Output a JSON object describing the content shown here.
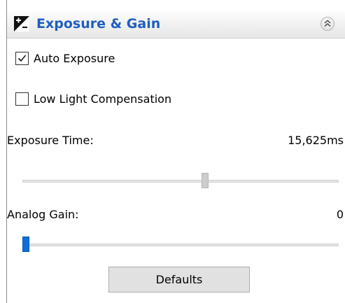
{
  "header": {
    "title": "Exposure & Gain",
    "icon": "exposure-icon",
    "collapse_icon": "double-chevron-up-icon",
    "title_color": "#1f5fbf"
  },
  "controls": {
    "auto_exposure": {
      "label": "Auto Exposure",
      "checked": true
    },
    "low_light": {
      "label": "Low Light Compensation",
      "checked": false
    },
    "exposure_time": {
      "label": "Exposure Time:",
      "value": "15,625ms",
      "slider_level": 0.58
    },
    "analog_gain": {
      "label": "Analog Gain:",
      "value": "0",
      "slider_level": 0.0
    }
  },
  "buttons": {
    "defaults": "Defaults"
  },
  "colors": {
    "accent": "#0a6fdc"
  }
}
